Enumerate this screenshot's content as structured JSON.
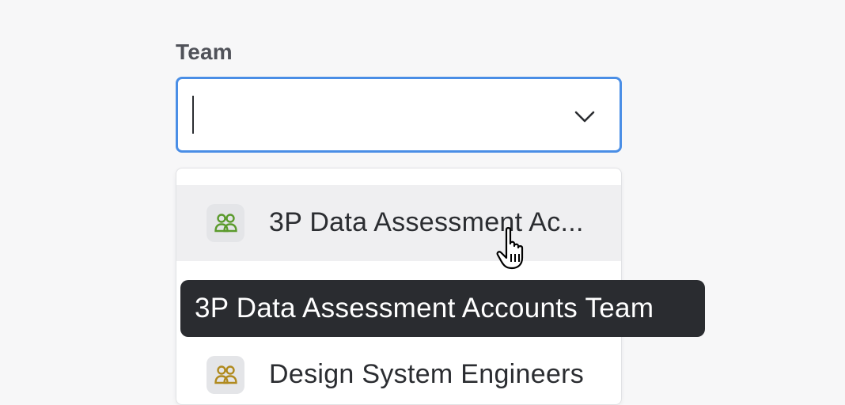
{
  "field": {
    "label": "Team",
    "value": "",
    "placeholder": ""
  },
  "dropdown": {
    "options": [
      {
        "label": "3P Data Assessment Ac...",
        "icon": "team-icon",
        "icon_color": "#5a9a2c",
        "hovered": true
      },
      {
        "label": "Design System Engineers",
        "icon": "team-icon",
        "icon_color": "#b08a1e",
        "hovered": false
      }
    ]
  },
  "tooltip": {
    "text": "3P Data Assessment Accounts Team"
  },
  "colors": {
    "focus_border": "#4a8ee6",
    "hover_background": "#efeff1",
    "tooltip_background": "#2a2c30"
  }
}
